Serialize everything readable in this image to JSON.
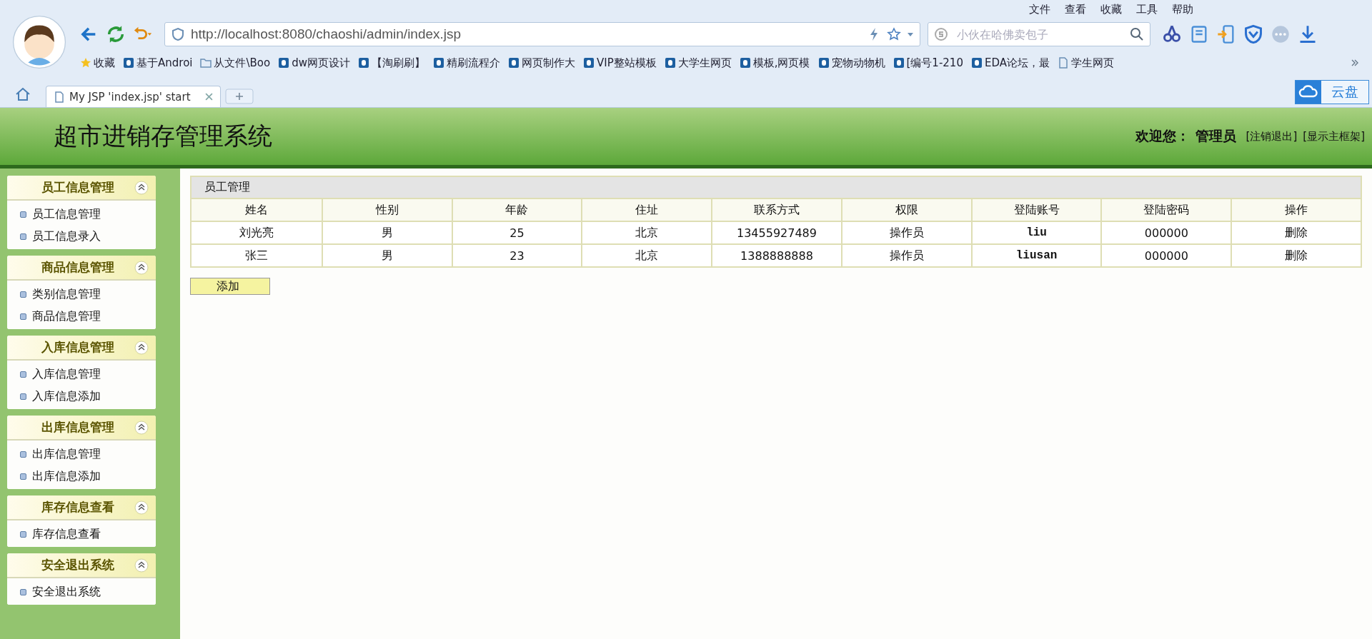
{
  "browser": {
    "menu": [
      "文件",
      "查看",
      "收藏",
      "工具",
      "帮助"
    ],
    "address": {
      "value": "http://localhost:8080/chaoshi/admin/index.jsp"
    },
    "search": {
      "placeholder": "小伙在哈佛卖包子"
    },
    "bookmarks": [
      {
        "label": "收藏",
        "kind": "star"
      },
      {
        "label": "基于Androi",
        "kind": "square"
      },
      {
        "label": "从文件\\Boo",
        "kind": "folder"
      },
      {
        "label": "dw网页设计",
        "kind": "square"
      },
      {
        "label": "【淘刷刷】",
        "kind": "square"
      },
      {
        "label": "精刷流程介",
        "kind": "square"
      },
      {
        "label": "网页制作大",
        "kind": "square"
      },
      {
        "label": "VIP整站模板",
        "kind": "square"
      },
      {
        "label": "大学生网页",
        "kind": "square"
      },
      {
        "label": "模板,网页模",
        "kind": "square"
      },
      {
        "label": "宠物动物机",
        "kind": "square"
      },
      {
        "label": "[编号1-210",
        "kind": "square"
      },
      {
        "label": "EDA论坛，最",
        "kind": "square"
      },
      {
        "label": "学生网页",
        "kind": "page"
      }
    ],
    "tabs": [
      {
        "label": "My JSP 'index.jsp' start",
        "selected": true
      }
    ],
    "cloud": "云盘"
  },
  "header": {
    "title": "超市进销存管理系统",
    "welcome": "欢迎您：",
    "user": "管理员",
    "links": [
      "[注销退出]",
      "[显示主框架]"
    ]
  },
  "sidebar": [
    {
      "title": "员工信息管理",
      "expanded": true,
      "items": [
        "员工信息管理",
        "员工信息录入"
      ]
    },
    {
      "title": "商品信息管理",
      "expanded": true,
      "items": [
        "类别信息管理",
        "商品信息管理"
      ]
    },
    {
      "title": "入库信息管理",
      "expanded": true,
      "items": [
        "入库信息管理",
        "入库信息添加"
      ]
    },
    {
      "title": "出库信息管理",
      "expanded": true,
      "items": [
        "出库信息管理",
        "出库信息添加"
      ]
    },
    {
      "title": "库存信息查看",
      "expanded": true,
      "items": [
        "库存信息查看"
      ]
    },
    {
      "title": "安全退出系统",
      "expanded": true,
      "items": [
        "安全退出系统"
      ]
    }
  ],
  "table": {
    "title": "员工管理",
    "columns": [
      "姓名",
      "性别",
      "年龄",
      "住址",
      "联系方式",
      "权限",
      "登陆账号",
      "登陆密码",
      "操作"
    ],
    "rows": [
      [
        "刘光亮",
        "男",
        "25",
        "北京",
        "13455927489",
        "操作员",
        "liu",
        "000000",
        "删除"
      ],
      [
        "张三",
        "男",
        "23",
        "北京",
        "1388888888",
        "操作员",
        "liusan",
        "000000",
        "删除"
      ]
    ]
  },
  "add_button": "添加"
}
